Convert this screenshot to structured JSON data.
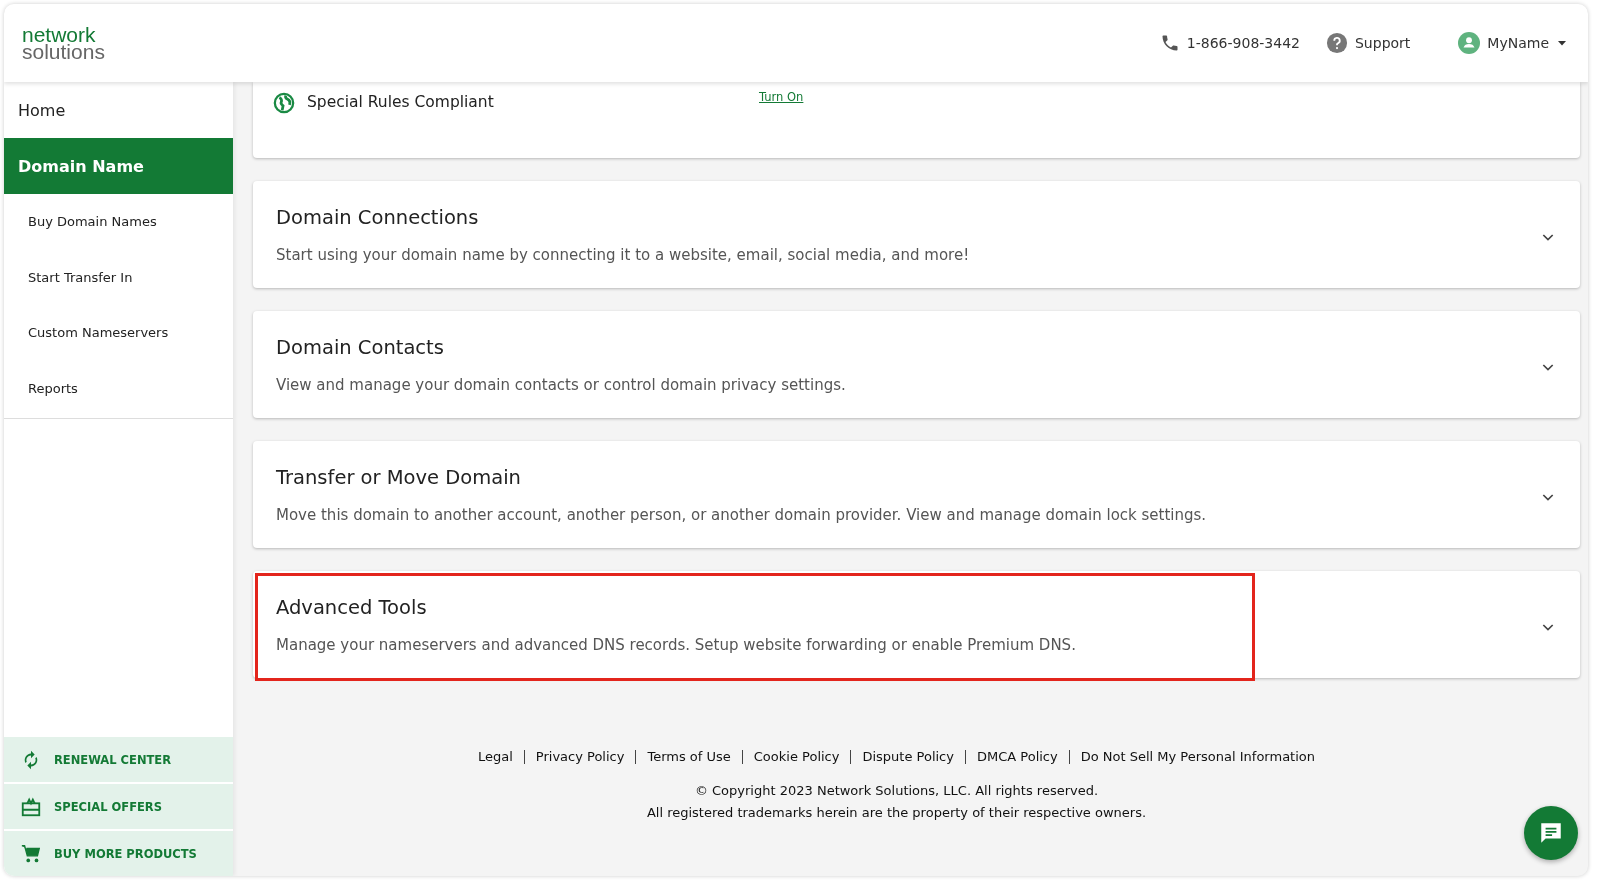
{
  "header": {
    "logo": {
      "line1": "network",
      "line2": "solutions"
    },
    "phone": "1-866-908-3442",
    "support": "Support",
    "user": "MyName"
  },
  "sidebar": {
    "items": [
      {
        "label": "Home",
        "selected": false
      },
      {
        "label": "Domain Name",
        "selected": true,
        "children": [
          {
            "label": "Buy Domain Names",
            "selected": false
          },
          {
            "label": "Start Transfer In",
            "selected": false
          },
          {
            "label": "Custom Nameservers",
            "selected": false
          },
          {
            "label": "Reports",
            "selected": false
          }
        ]
      }
    ],
    "promos": [
      {
        "kind": "renew",
        "label": "RENEWAL CENTER"
      },
      {
        "kind": "gift",
        "label": "SPECIAL OFFERS"
      },
      {
        "kind": "cart",
        "label": "BUY MORE PRODUCTS"
      }
    ]
  },
  "top_card": {
    "label": "Special Rules Compliant",
    "link": "Turn On"
  },
  "sections": [
    {
      "title": "Domain Connections",
      "description": "Start using your domain name by connecting it to a website, email, social media, and more!",
      "expanded": false,
      "highlighted": false
    },
    {
      "title": "Domain Contacts",
      "description": "View and manage your domain contacts or control domain privacy settings.",
      "expanded": false,
      "highlighted": false
    },
    {
      "title": "Transfer or Move Domain",
      "description": "Move this domain to another account, another person, or another domain provider. View and manage domain lock settings.",
      "expanded": false,
      "highlighted": false
    },
    {
      "title": "Advanced Tools",
      "description": "Manage your nameservers and advanced DNS records. Setup website forwarding or enable Premium DNS.",
      "expanded": false,
      "highlighted": true
    }
  ],
  "footer": {
    "links": [
      "Legal",
      "Privacy Policy",
      "Terms of Use",
      "Cookie Policy",
      "Dispute Policy",
      "DMCA Policy",
      "Do Not Sell My Personal Information"
    ],
    "copyright": "© Copyright 2023 Network Solutions, LLC. All rights reserved.",
    "trademark": "All registered trademarks herein are the property of their respective owners."
  }
}
